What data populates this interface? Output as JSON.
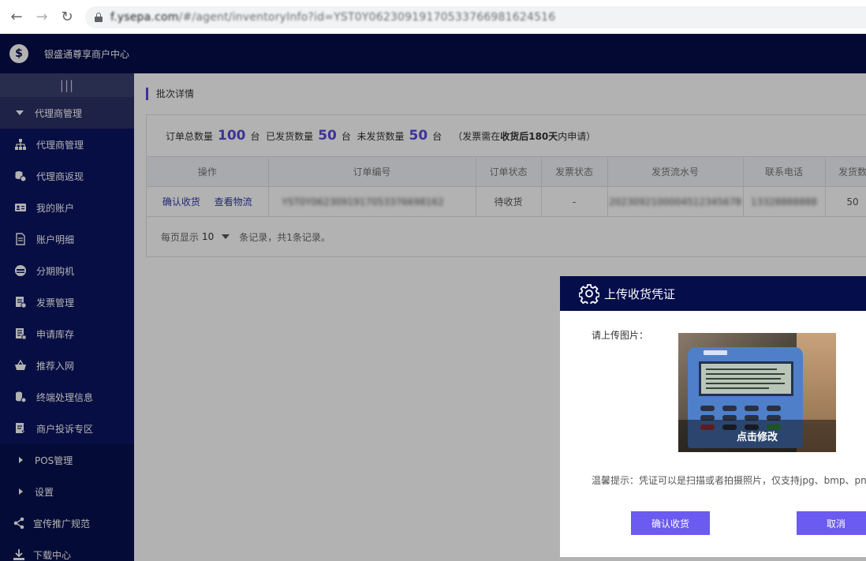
{
  "browser": {
    "url_host": "f.ysepa.com",
    "url_path": "/#/agent/inventoryInfo?id=YST0Y06230919170533766981624516"
  },
  "header": {
    "app_title": "银盛通尊享商户中心"
  },
  "sidebar": {
    "groups": [
      {
        "label": "代理商管理",
        "open": true,
        "items": [
          {
            "label": "代理商管理",
            "icon": "org-chart-icon"
          },
          {
            "label": "代理商返现",
            "icon": "coins-icon"
          },
          {
            "label": "我的账户",
            "icon": "id-card-icon"
          },
          {
            "label": "账户明细",
            "icon": "document-icon"
          },
          {
            "label": "分期购机",
            "icon": "credit-card-icon"
          },
          {
            "label": "发票管理",
            "icon": "invoice-icon"
          },
          {
            "label": "申请库存",
            "icon": "stock-icon"
          },
          {
            "label": "推荐入网",
            "icon": "basket-icon"
          },
          {
            "label": "终端处理信息",
            "icon": "terminal-coins-icon"
          },
          {
            "label": "商户投诉专区",
            "icon": "complaint-icon"
          }
        ]
      },
      {
        "label": "POS管理",
        "open": false
      },
      {
        "label": "设置",
        "open": false
      },
      {
        "label": "宣传推广规范",
        "icon": "share-icon"
      },
      {
        "label": "下载中心",
        "icon": "download-icon"
      }
    ]
  },
  "main": {
    "breadcrumb": "批次详情",
    "summary": {
      "total_label": "订单总数量",
      "total": "100",
      "unit": "台",
      "shipped_label": "已发货数量",
      "shipped": "50",
      "unshipped_label": "未发货数量",
      "unshipped": "50",
      "note_prefix": "（发票需在",
      "note_bold": "收货后180天",
      "note_suffix": "内申请）"
    },
    "table": {
      "columns": [
        "操作",
        "订单编号",
        "订单状态",
        "发票状态",
        "发货流水号",
        "联系电话",
        "发货数"
      ],
      "rows": [
        {
          "action_confirm": "确认收货",
          "action_logistics": "查看物流",
          "order_no": "YST0Y0623091917053376698162",
          "order_status": "待收货",
          "invoice_status": "-",
          "ship_serial": "2023092100004512345678",
          "phone": "13328888888",
          "qty": "50"
        }
      ]
    },
    "pager": {
      "per_page_label": "每页显示",
      "per_page": "10",
      "records_text": "条记录，共1条记录。"
    }
  },
  "modal": {
    "title": "上传收货凭证",
    "upload_label": "请上传图片：",
    "photo_caption": "点击修改",
    "hint": "温馨提示：凭证可以是扫描或者拍摄照片，仅支持jpg、bmp、pn",
    "confirm_label": "确认收货",
    "cancel_label": "取消"
  },
  "colors": {
    "header_bg": "#050d4a",
    "sidebar_bg": "#07104e",
    "accent": "#5a4ad8",
    "button": "#6b5bf0"
  }
}
